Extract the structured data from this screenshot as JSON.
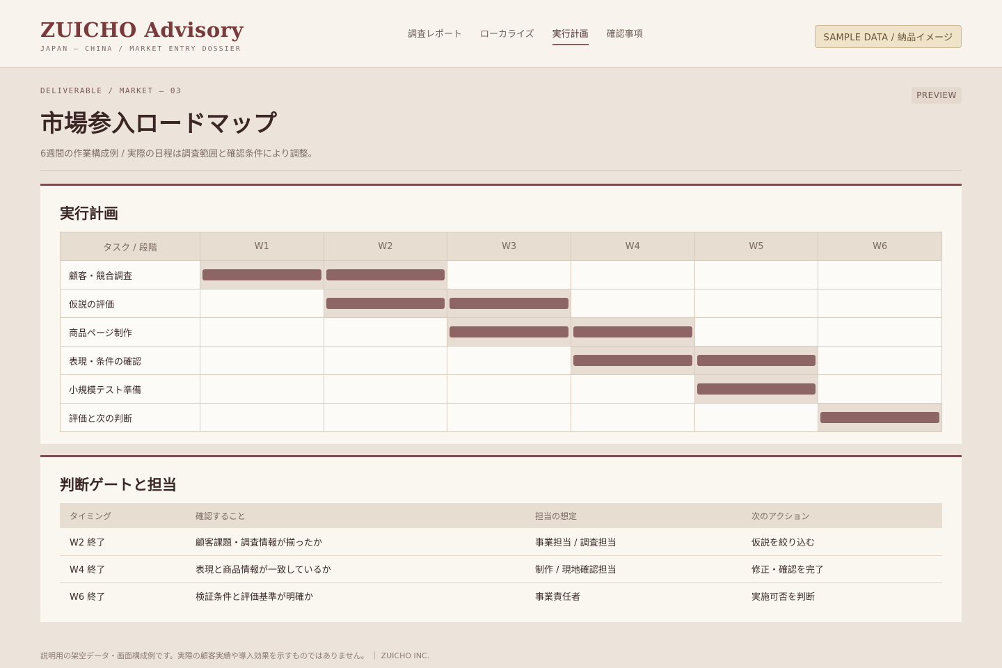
{
  "header": {
    "logo": "ZUICHO Advisory",
    "tagline": "JAPAN — CHINA / MARKET ENTRY DOSSIER",
    "nav": [
      {
        "label": "調査レポート",
        "active": false
      },
      {
        "label": "ローカライズ",
        "active": false
      },
      {
        "label": "実行計画",
        "active": true
      },
      {
        "label": "確認事項",
        "active": false
      }
    ],
    "sample_label": "SAMPLE DATA / 納品イメージ"
  },
  "page": {
    "crumb": "DELIVERABLE / MARKET — 03",
    "badge": "PREVIEW",
    "title": "市場参入ロードマップ",
    "subtitle": "6週間の作業構成例 / 実際の日程は調査範囲と確認条件により調整。"
  },
  "plan": {
    "title": "実行計画",
    "task_header": "タスク / 段階",
    "weeks": [
      "W1",
      "W2",
      "W3",
      "W4",
      "W5",
      "W6"
    ],
    "tasks": [
      {
        "name": "顧客・競合調査",
        "start": 1,
        "end": 2
      },
      {
        "name": "仮説の評価",
        "start": 2,
        "end": 3
      },
      {
        "name": "商品ページ制作",
        "start": 3,
        "end": 4
      },
      {
        "name": "表現・条件の確認",
        "start": 4,
        "end": 5
      },
      {
        "name": "小規模テスト準備",
        "start": 5,
        "end": 5
      },
      {
        "name": "評価と次の判断",
        "start": 6,
        "end": 6
      }
    ],
    "colors": {
      "bar": "#8d6564",
      "highlight": "#e8ddd2"
    }
  },
  "gates": {
    "title": "判断ゲートと担当",
    "headers": [
      "タイミング",
      "確認すること",
      "担当の想定",
      "次のアクション"
    ],
    "rows": [
      [
        "W2 終了",
        "顧客課題・調査情報が揃ったか",
        "事業担当 / 調査担当",
        "仮説を絞り込む"
      ],
      [
        "W4 終了",
        "表現と商品情報が一致しているか",
        "制作 / 現地確認担当",
        "修正・確認を完了"
      ],
      [
        "W6 終了",
        "検証条件と評価基準が明確か",
        "事業責任者",
        "実施可否を判断"
      ]
    ]
  },
  "footer": "説明用の架空データ・画面構成例です。実際の顧客実績や導入効果を示すものではありません。 ｜ ZUICHO INC."
}
